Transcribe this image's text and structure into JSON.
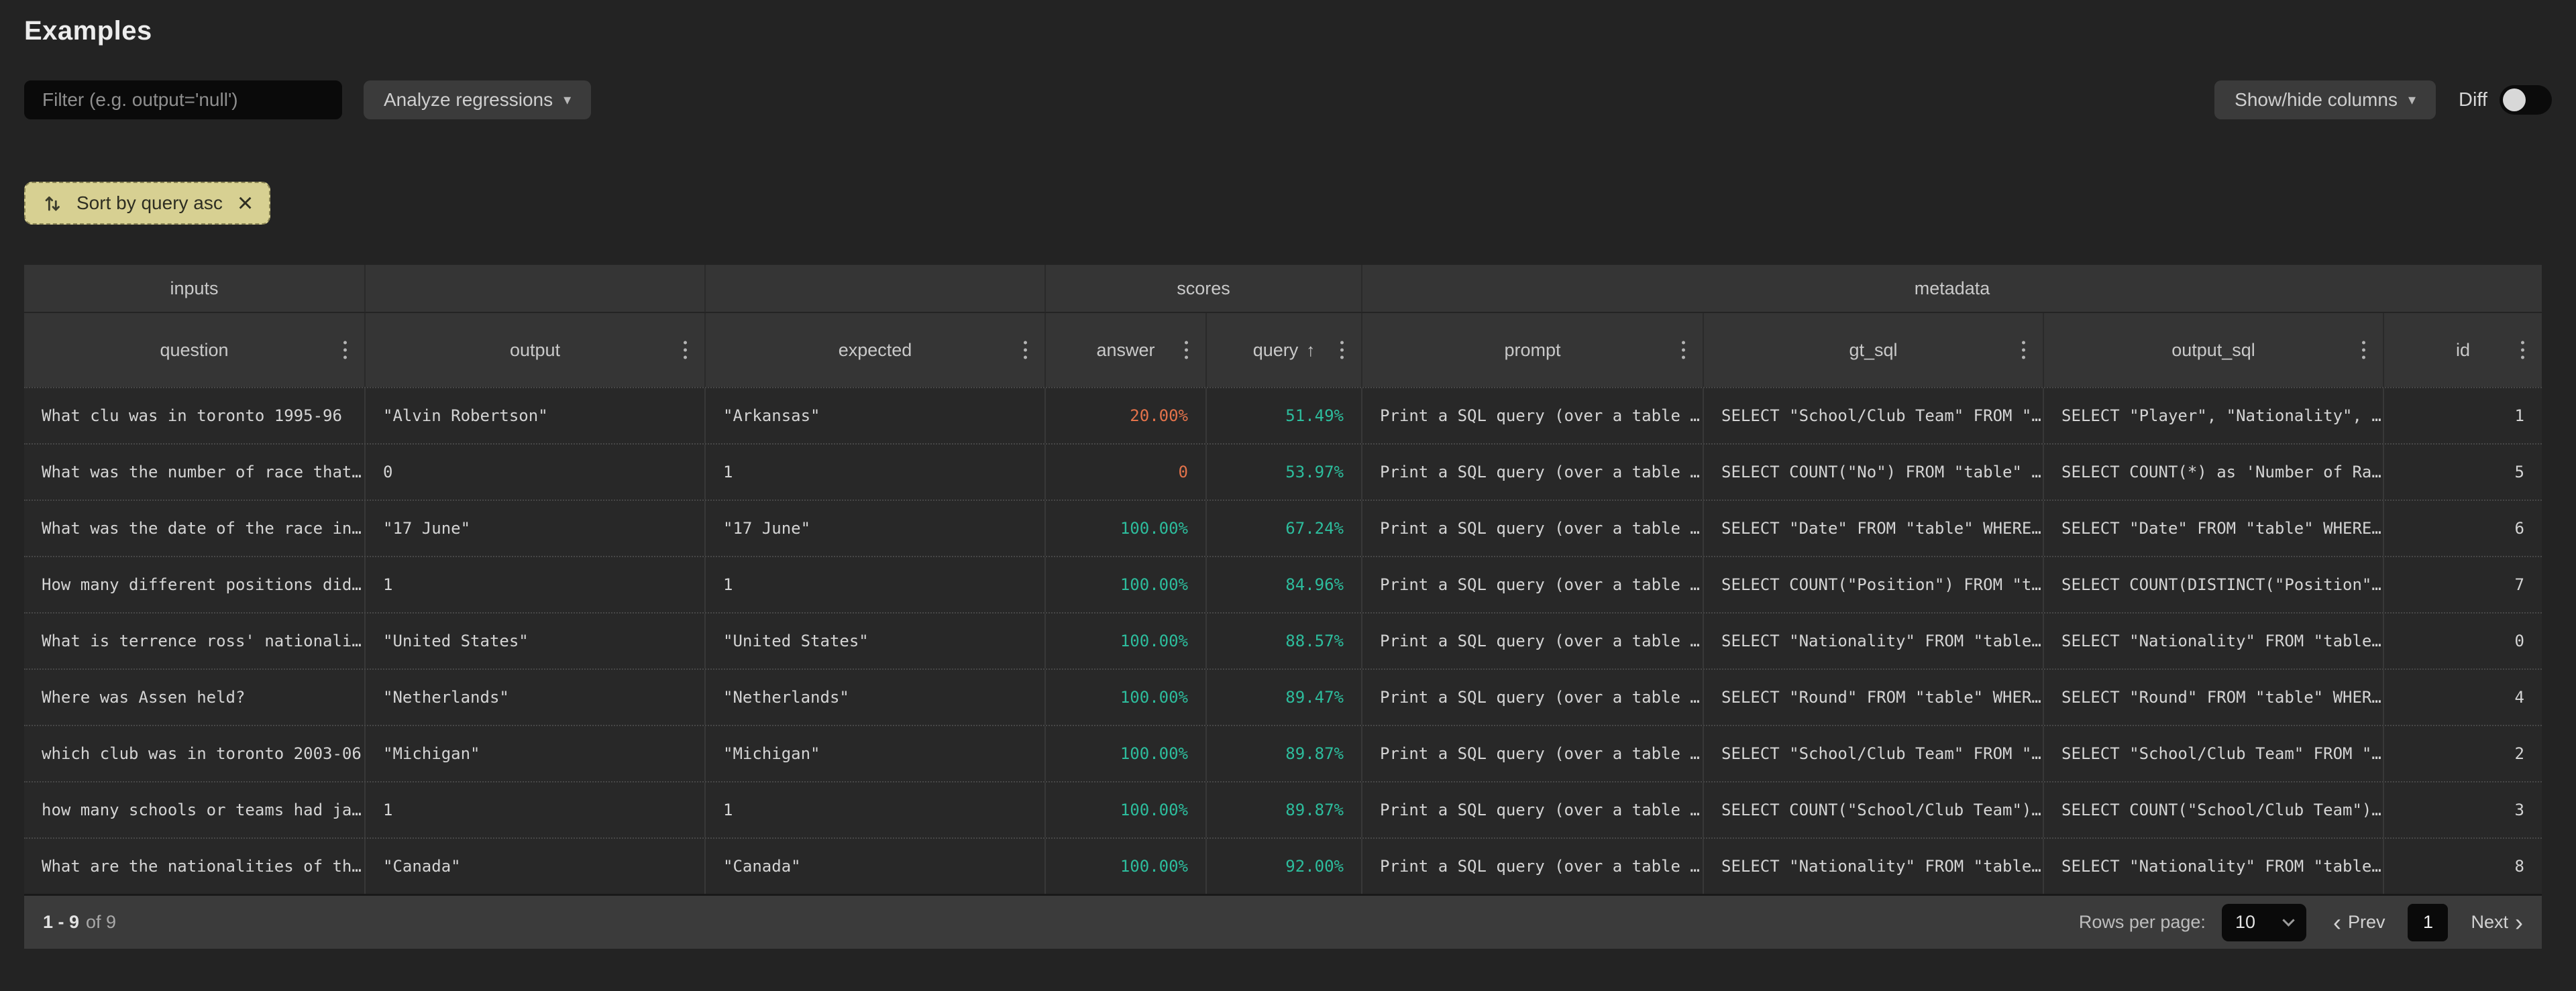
{
  "title": "Examples",
  "toolbar": {
    "filter_placeholder": "Filter (e.g. output='null')",
    "analyze_button": "Analyze regressions",
    "show_hide_columns": "Show/hide columns",
    "diff_label": "Diff",
    "diff_state": "off"
  },
  "sort_chip": {
    "label": "Sort by query asc",
    "close": "×"
  },
  "colors": {
    "positive": "#2dbd9d",
    "negative": "#e4734b",
    "chip_bg": "#d7d092"
  },
  "groups": [
    {
      "label": "inputs"
    },
    {
      "label": ""
    },
    {
      "label": ""
    },
    {
      "label": "scores"
    },
    {
      "label": "metadata"
    }
  ],
  "columns": [
    {
      "label": "question"
    },
    {
      "label": "output"
    },
    {
      "label": "expected"
    },
    {
      "label": "answer"
    },
    {
      "label": "query",
      "sort_indicator": "↑"
    },
    {
      "label": "prompt"
    },
    {
      "label": "gt_sql"
    },
    {
      "label": "output_sql"
    },
    {
      "label": "id"
    }
  ],
  "rows": [
    {
      "question": "What clu was in toronto 1995-96",
      "output": "\"Alvin Robertson\"",
      "expected": "\"Arkansas\"",
      "answer": "20.00%",
      "query": "51.49%",
      "prompt": "Print a SQL query (over a table …",
      "gt_sql": "SELECT \"School/Club Team\" FROM \"…",
      "output_sql": "SELECT \"Player\", \"Nationality\", …",
      "id": "1"
    },
    {
      "question": "What was the number of race that…",
      "output": "0",
      "expected": "1",
      "answer": "0",
      "query": "53.97%",
      "prompt": "Print a SQL query (over a table …",
      "gt_sql": "SELECT COUNT(\"No\") FROM \"table\" …",
      "output_sql": "SELECT COUNT(*) as 'Number of Ra…",
      "id": "5"
    },
    {
      "question": "What was the date of the race in…",
      "output": "\"17 June\"",
      "expected": "\"17 June\"",
      "answer": "100.00%",
      "query": "67.24%",
      "prompt": "Print a SQL query (over a table …",
      "gt_sql": "SELECT \"Date\" FROM \"table\" WHERE…",
      "output_sql": "SELECT \"Date\" FROM \"table\" WHERE…",
      "id": "6"
    },
    {
      "question": "How many different positions did…",
      "output": "1",
      "expected": "1",
      "answer": "100.00%",
      "query": "84.96%",
      "prompt": "Print a SQL query (over a table …",
      "gt_sql": "SELECT COUNT(\"Position\") FROM \"t…",
      "output_sql": "SELECT COUNT(DISTINCT(\"Position\"…",
      "id": "7"
    },
    {
      "question": "What is terrence ross' nationali…",
      "output": "\"United States\"",
      "expected": "\"United States\"",
      "answer": "100.00%",
      "query": "88.57%",
      "prompt": "Print a SQL query (over a table …",
      "gt_sql": "SELECT \"Nationality\" FROM \"table…",
      "output_sql": "SELECT \"Nationality\" FROM \"table…",
      "id": "0"
    },
    {
      "question": "Where was Assen held?",
      "output": "\"Netherlands\"",
      "expected": "\"Netherlands\"",
      "answer": "100.00%",
      "query": "89.47%",
      "prompt": "Print a SQL query (over a table …",
      "gt_sql": "SELECT \"Round\" FROM \"table\" WHER…",
      "output_sql": "SELECT \"Round\" FROM \"table\" WHER…",
      "id": "4"
    },
    {
      "question": "which club was in toronto 2003-06",
      "output": "\"Michigan\"",
      "expected": "\"Michigan\"",
      "answer": "100.00%",
      "query": "89.87%",
      "prompt": "Print a SQL query (over a table …",
      "gt_sql": "SELECT \"School/Club Team\" FROM \"…",
      "output_sql": "SELECT \"School/Club Team\" FROM \"…",
      "id": "2"
    },
    {
      "question": "how many schools or teams had ja…",
      "output": "1",
      "expected": "1",
      "answer": "100.00%",
      "query": "89.87%",
      "prompt": "Print a SQL query (over a table …",
      "gt_sql": "SELECT COUNT(\"School/Club Team\")…",
      "output_sql": "SELECT COUNT(\"School/Club Team\")…",
      "id": "3"
    },
    {
      "question": "What are the nationalities of th…",
      "output": "\"Canada\"",
      "expected": "\"Canada\"",
      "answer": "100.00%",
      "query": "92.00%",
      "prompt": "Print a SQL query (over a table …",
      "gt_sql": "SELECT \"Nationality\" FROM \"table…",
      "output_sql": "SELECT \"Nationality\" FROM \"table…",
      "id": "8"
    }
  ],
  "footer": {
    "range": "1 - 9",
    "total": "of 9",
    "rows_per_page_label": "Rows per page:",
    "rows_per_page": "10",
    "prev_label": "Prev",
    "next_label": "Next",
    "page": "1"
  }
}
